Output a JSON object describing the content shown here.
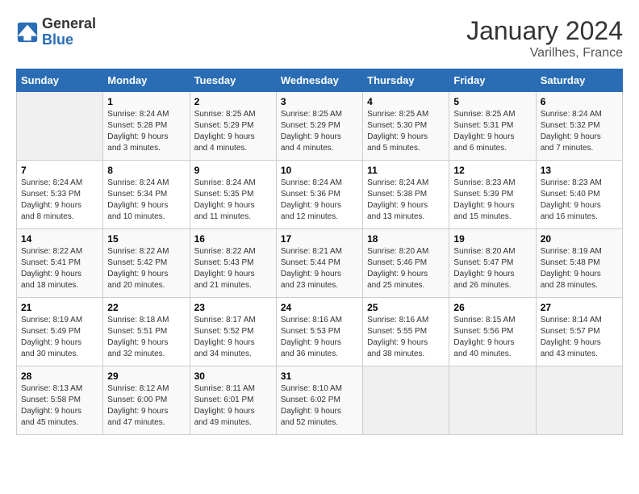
{
  "logo": {
    "general": "General",
    "blue": "Blue"
  },
  "title": "January 2024",
  "subtitle": "Varilhes, France",
  "days_of_week": [
    "Sunday",
    "Monday",
    "Tuesday",
    "Wednesday",
    "Thursday",
    "Friday",
    "Saturday"
  ],
  "weeks": [
    [
      {
        "day": "",
        "info": ""
      },
      {
        "day": "1",
        "info": "Sunrise: 8:24 AM\nSunset: 5:28 PM\nDaylight: 9 hours\nand 3 minutes."
      },
      {
        "day": "2",
        "info": "Sunrise: 8:25 AM\nSunset: 5:29 PM\nDaylight: 9 hours\nand 4 minutes."
      },
      {
        "day": "3",
        "info": "Sunrise: 8:25 AM\nSunset: 5:29 PM\nDaylight: 9 hours\nand 4 minutes."
      },
      {
        "day": "4",
        "info": "Sunrise: 8:25 AM\nSunset: 5:30 PM\nDaylight: 9 hours\nand 5 minutes."
      },
      {
        "day": "5",
        "info": "Sunrise: 8:25 AM\nSunset: 5:31 PM\nDaylight: 9 hours\nand 6 minutes."
      },
      {
        "day": "6",
        "info": "Sunrise: 8:24 AM\nSunset: 5:32 PM\nDaylight: 9 hours\nand 7 minutes."
      }
    ],
    [
      {
        "day": "7",
        "info": "Sunrise: 8:24 AM\nSunset: 5:33 PM\nDaylight: 9 hours\nand 8 minutes."
      },
      {
        "day": "8",
        "info": "Sunrise: 8:24 AM\nSunset: 5:34 PM\nDaylight: 9 hours\nand 10 minutes."
      },
      {
        "day": "9",
        "info": "Sunrise: 8:24 AM\nSunset: 5:35 PM\nDaylight: 9 hours\nand 11 minutes."
      },
      {
        "day": "10",
        "info": "Sunrise: 8:24 AM\nSunset: 5:36 PM\nDaylight: 9 hours\nand 12 minutes."
      },
      {
        "day": "11",
        "info": "Sunrise: 8:24 AM\nSunset: 5:38 PM\nDaylight: 9 hours\nand 13 minutes."
      },
      {
        "day": "12",
        "info": "Sunrise: 8:23 AM\nSunset: 5:39 PM\nDaylight: 9 hours\nand 15 minutes."
      },
      {
        "day": "13",
        "info": "Sunrise: 8:23 AM\nSunset: 5:40 PM\nDaylight: 9 hours\nand 16 minutes."
      }
    ],
    [
      {
        "day": "14",
        "info": "Sunrise: 8:22 AM\nSunset: 5:41 PM\nDaylight: 9 hours\nand 18 minutes."
      },
      {
        "day": "15",
        "info": "Sunrise: 8:22 AM\nSunset: 5:42 PM\nDaylight: 9 hours\nand 20 minutes."
      },
      {
        "day": "16",
        "info": "Sunrise: 8:22 AM\nSunset: 5:43 PM\nDaylight: 9 hours\nand 21 minutes."
      },
      {
        "day": "17",
        "info": "Sunrise: 8:21 AM\nSunset: 5:44 PM\nDaylight: 9 hours\nand 23 minutes."
      },
      {
        "day": "18",
        "info": "Sunrise: 8:20 AM\nSunset: 5:46 PM\nDaylight: 9 hours\nand 25 minutes."
      },
      {
        "day": "19",
        "info": "Sunrise: 8:20 AM\nSunset: 5:47 PM\nDaylight: 9 hours\nand 26 minutes."
      },
      {
        "day": "20",
        "info": "Sunrise: 8:19 AM\nSunset: 5:48 PM\nDaylight: 9 hours\nand 28 minutes."
      }
    ],
    [
      {
        "day": "21",
        "info": "Sunrise: 8:19 AM\nSunset: 5:49 PM\nDaylight: 9 hours\nand 30 minutes."
      },
      {
        "day": "22",
        "info": "Sunrise: 8:18 AM\nSunset: 5:51 PM\nDaylight: 9 hours\nand 32 minutes."
      },
      {
        "day": "23",
        "info": "Sunrise: 8:17 AM\nSunset: 5:52 PM\nDaylight: 9 hours\nand 34 minutes."
      },
      {
        "day": "24",
        "info": "Sunrise: 8:16 AM\nSunset: 5:53 PM\nDaylight: 9 hours\nand 36 minutes."
      },
      {
        "day": "25",
        "info": "Sunrise: 8:16 AM\nSunset: 5:55 PM\nDaylight: 9 hours\nand 38 minutes."
      },
      {
        "day": "26",
        "info": "Sunrise: 8:15 AM\nSunset: 5:56 PM\nDaylight: 9 hours\nand 40 minutes."
      },
      {
        "day": "27",
        "info": "Sunrise: 8:14 AM\nSunset: 5:57 PM\nDaylight: 9 hours\nand 43 minutes."
      }
    ],
    [
      {
        "day": "28",
        "info": "Sunrise: 8:13 AM\nSunset: 5:58 PM\nDaylight: 9 hours\nand 45 minutes."
      },
      {
        "day": "29",
        "info": "Sunrise: 8:12 AM\nSunset: 6:00 PM\nDaylight: 9 hours\nand 47 minutes."
      },
      {
        "day": "30",
        "info": "Sunrise: 8:11 AM\nSunset: 6:01 PM\nDaylight: 9 hours\nand 49 minutes."
      },
      {
        "day": "31",
        "info": "Sunrise: 8:10 AM\nSunset: 6:02 PM\nDaylight: 9 hours\nand 52 minutes."
      },
      {
        "day": "",
        "info": ""
      },
      {
        "day": "",
        "info": ""
      },
      {
        "day": "",
        "info": ""
      }
    ]
  ]
}
